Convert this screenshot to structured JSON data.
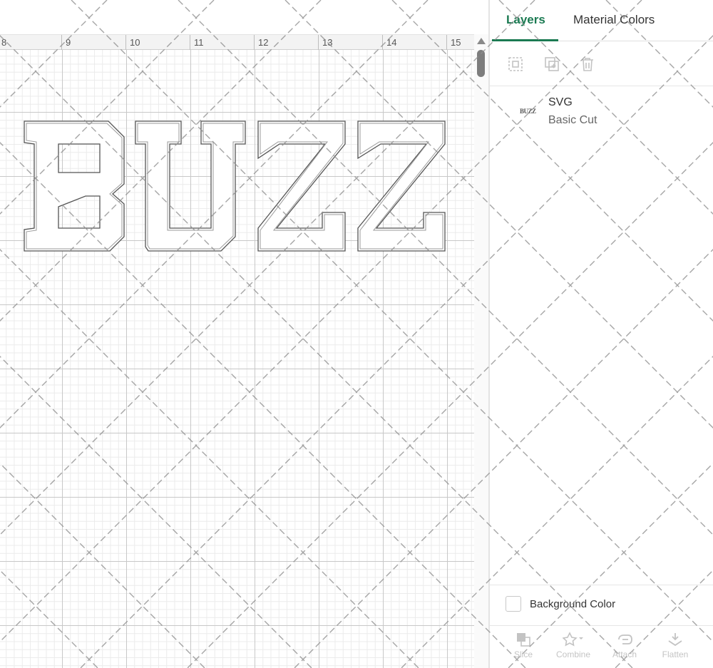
{
  "ruler": {
    "labels": [
      "8",
      "9",
      "10",
      "11",
      "12",
      "13",
      "14",
      "15"
    ]
  },
  "artwork": {
    "text": "BUZZ"
  },
  "panel": {
    "tabs": {
      "layers": "Layers",
      "material_colors": "Material Colors"
    },
    "accent_color": "#1b7a52",
    "tools": [
      "group-icon",
      "duplicate-icon",
      "delete-icon"
    ],
    "layer": {
      "thumb_text": "BUZZ",
      "name": "SVG",
      "type": "Basic Cut"
    },
    "background_color_label": "Background Color",
    "actions": [
      "Slice",
      "Combine",
      "Attach",
      "Flatten"
    ]
  }
}
